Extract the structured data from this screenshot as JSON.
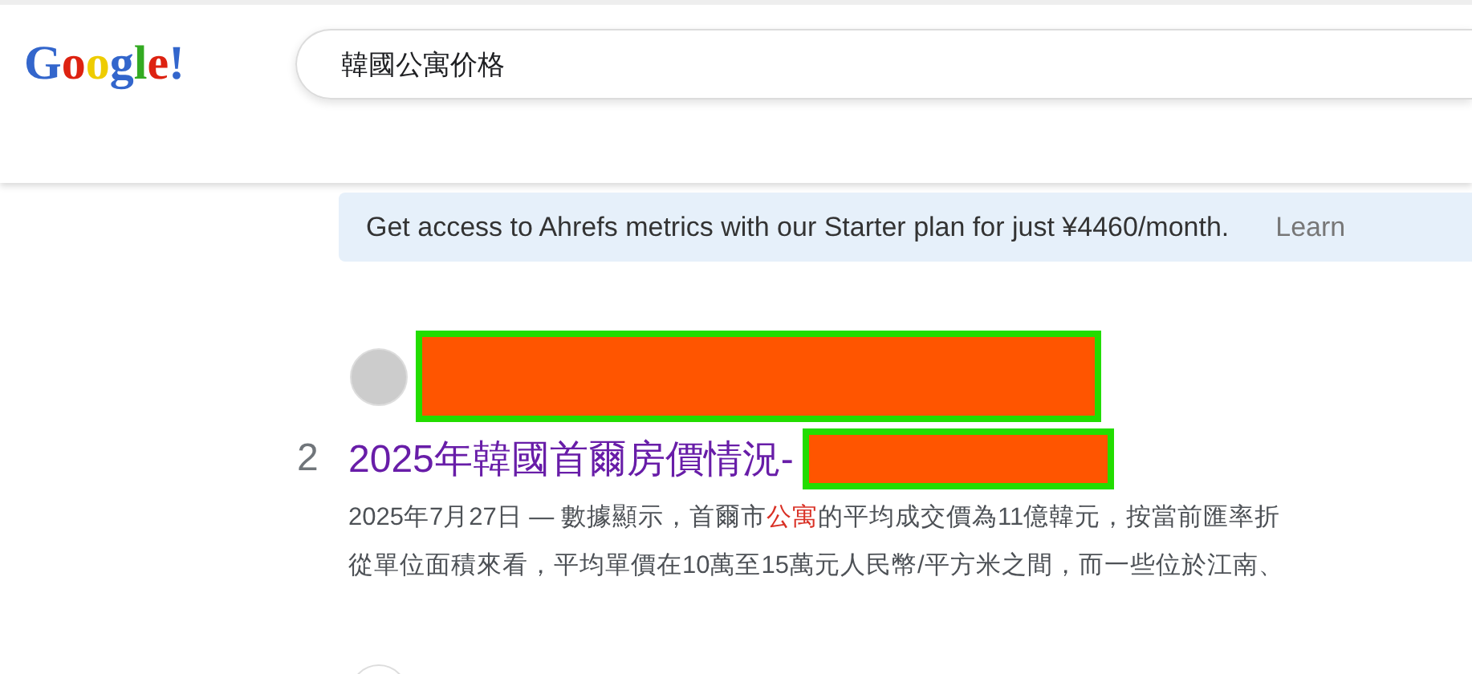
{
  "header": {
    "logo": [
      {
        "text": "G",
        "color": "#3366cc"
      },
      {
        "text": "o",
        "color": "#dd2211"
      },
      {
        "text": "o",
        "color": "#eecc00"
      },
      {
        "text": "g",
        "color": "#3366cc"
      },
      {
        "text": "l",
        "color": "#33aa22"
      },
      {
        "text": "e",
        "color": "#dd2211"
      },
      {
        "text": "!",
        "color": "#3366cc"
      }
    ],
    "search": {
      "value": "韓國公寓价格"
    }
  },
  "banner": {
    "text": "Get access to Ahrefs metrics with our Starter plan for just ¥4460/month.",
    "link": "Learn"
  },
  "results": [
    {
      "number": "2",
      "title": "2025年韓國首爾房價情況-",
      "snippet_lines": [
        [
          {
            "text": "2025年7月27日 — 數據顯示，首爾市",
            "highlight": false
          },
          {
            "text": "公寓",
            "highlight": true
          },
          {
            "text": "的平均成交價為11億韓元，按當前匯率折",
            "highlight": false
          }
        ],
        [
          {
            "text": "從單位面積來看，平均單價在10萬至15萬元人民幣/平方米之間，而一些位於江南、",
            "highlight": false
          }
        ]
      ]
    }
  ]
}
